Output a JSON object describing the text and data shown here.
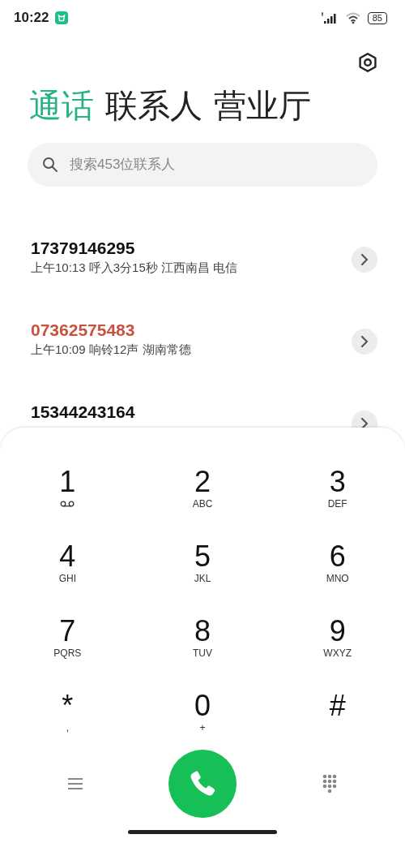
{
  "status_bar": {
    "time": "10:22",
    "battery": "85"
  },
  "tabs": [
    {
      "label": "通话",
      "selected": true
    },
    {
      "label": "联系人",
      "selected": false
    },
    {
      "label": "营业厅",
      "selected": false
    }
  ],
  "search": {
    "placeholder": "搜索453位联系人"
  },
  "calls": [
    {
      "number": "17379146295",
      "detail": "上午10:13 呼入3分15秒 江西南昌 电信",
      "missed": false
    },
    {
      "number": "07362575483",
      "detail": "上午10:09 响铃12声 湖南常德",
      "missed": true
    },
    {
      "number": "15344243164",
      "missed": false
    }
  ],
  "keypad": [
    {
      "digit": "1",
      "kind": "voicemail"
    },
    {
      "digit": "2",
      "letters": "ABC",
      "kind": "letters"
    },
    {
      "digit": "3",
      "letters": "DEF",
      "kind": "letters"
    },
    {
      "digit": "4",
      "letters": "GHI",
      "kind": "letters"
    },
    {
      "digit": "5",
      "letters": "JKL",
      "kind": "letters"
    },
    {
      "digit": "6",
      "letters": "MNO",
      "kind": "letters"
    },
    {
      "digit": "7",
      "letters": "PQRS",
      "kind": "letters"
    },
    {
      "digit": "8",
      "letters": "TUV",
      "kind": "letters"
    },
    {
      "digit": "9",
      "letters": "WXYZ",
      "kind": "letters"
    },
    {
      "digit": "*",
      "letters": ",",
      "kind": "letters"
    },
    {
      "digit": "0",
      "letters": "+",
      "kind": "letters"
    },
    {
      "digit": "#",
      "kind": "plain"
    }
  ]
}
